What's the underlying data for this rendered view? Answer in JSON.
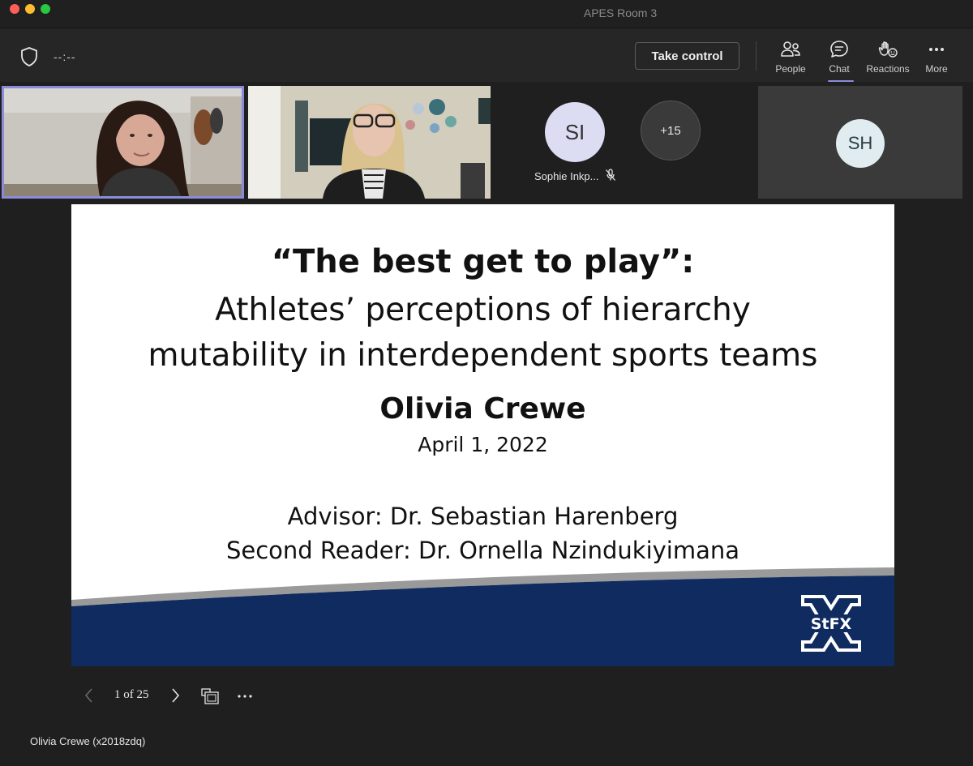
{
  "window": {
    "title": "APES Room 3"
  },
  "toolbar": {
    "timer": "--:--",
    "take_control": "Take control",
    "buttons": [
      {
        "label": "People",
        "icon": "people-icon"
      },
      {
        "label": "Chat",
        "icon": "chat-icon",
        "active": true
      },
      {
        "label": "Reactions",
        "icon": "reactions-icon"
      },
      {
        "label": "More",
        "icon": "more-icon"
      }
    ]
  },
  "participants": {
    "si_initials": "SI",
    "si_name": "Sophie Inkp...",
    "overflow": "+15",
    "sh_initials": "SH"
  },
  "slide": {
    "title": "“The best get to play”:",
    "subtitle_line1": "Athletes’ perceptions of hierarchy",
    "subtitle_line2": "mutability in interdependent sports teams",
    "author": "Olivia Crewe",
    "date": "April 1, 2022",
    "advisor": "Advisor: Dr. Sebastian Harenberg",
    "second_reader": "Second Reader: Dr. Ornella Nzindukiyimana",
    "logo_text": "StFX",
    "colors": {
      "band": "#0f2b5f",
      "stripe": "#9a9a9a"
    }
  },
  "slide_nav": {
    "counter": "1 of 25"
  },
  "presenter": {
    "name": "Olivia Crewe (x2018zdq)"
  },
  "colors": {
    "accent": "#8b8cd9",
    "background": "#1f1f1f"
  }
}
